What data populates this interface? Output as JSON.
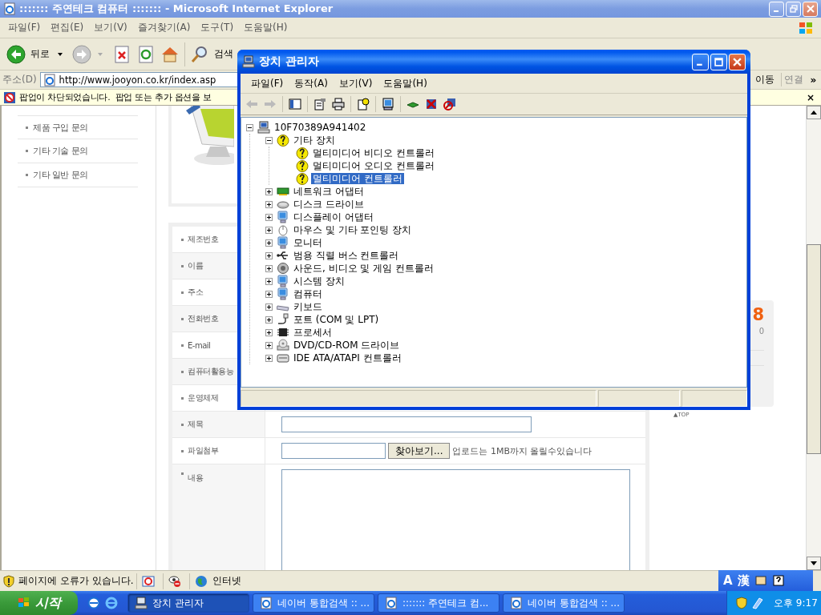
{
  "browser": {
    "title": "::::::: 주연테크 컴퓨터 ::::::: - Microsoft Internet Explorer",
    "menu": [
      "파일(F)",
      "편집(E)",
      "보기(V)",
      "즐겨찾기(A)",
      "도구(T)",
      "도움말(H)"
    ],
    "toolbar": {
      "back": "뒤로",
      "search": "검색"
    },
    "address": {
      "label": "주소(D)",
      "value": "http://www.jooyon.co.kr/index.asp",
      "go": "이동",
      "links": "연결",
      "more": "»"
    },
    "infobar": {
      "text": "팝업이 차단되었습니다.  팝업 또는 추가 옵션을 보",
      "close": "×"
    }
  },
  "page": {
    "sidebar_links": [
      "제품 구입 문의",
      "기타 기술 문의",
      "기타 일반 문의"
    ],
    "form_rows": [
      {
        "label": "제조번호",
        "kind": "label"
      },
      {
        "label": "이름",
        "kind": "label"
      },
      {
        "label": "주소",
        "kind": "label"
      },
      {
        "label": "전화번호",
        "kind": "label"
      },
      {
        "label": "E-mail",
        "kind": "label"
      },
      {
        "label": "컴퓨터활용능",
        "kind": "label"
      },
      {
        "label": "운영체제",
        "kind": "label"
      },
      {
        "label": "제목",
        "kind": "text"
      },
      {
        "label": "파일첨부",
        "kind": "file",
        "button": "찾아보기...",
        "note": "업로드는 1MB까지 올릴수있습니다"
      },
      {
        "label": "내용",
        "kind": "textarea"
      }
    ],
    "side_card": {
      "number": "8",
      "sub": "0"
    },
    "top_link": "▲TOP"
  },
  "status_bar": {
    "text": "페이지에 오류가 있습니다.",
    "zone": "인터넷"
  },
  "device_manager": {
    "title": "장치 관리자",
    "menu": [
      "파일(F)",
      "동작(A)",
      "보기(V)",
      "도움말(H)"
    ],
    "tree": {
      "label": "10F70389A941402",
      "kind": "computer",
      "expanded": true,
      "selected": false,
      "children": [
        {
          "label": "기타 장치",
          "kind": "unknown",
          "expanded": true,
          "selected": false,
          "children": [
            {
              "label": "멀티미디어 비디오 컨트롤러",
              "kind": "warning",
              "selected": false
            },
            {
              "label": "멀티미디어 오디오 컨트롤러",
              "kind": "warning",
              "selected": false
            },
            {
              "label": "멀티미디어 컨트롤러",
              "kind": "warning",
              "selected": true
            }
          ]
        },
        {
          "label": "네트워크 어댑터",
          "kind": "network",
          "expanded": false,
          "selected": false
        },
        {
          "label": "디스크 드라이브",
          "kind": "disk",
          "expanded": false,
          "selected": false
        },
        {
          "label": "디스플레이 어댑터",
          "kind": "display",
          "expanded": false,
          "selected": false
        },
        {
          "label": "마우스 및 기타 포인팅 장치",
          "kind": "mouse",
          "expanded": false,
          "selected": false
        },
        {
          "label": "모니터",
          "kind": "display",
          "expanded": false,
          "selected": false
        },
        {
          "label": "범용 직렬 버스 컨트롤러",
          "kind": "usb",
          "expanded": false,
          "selected": false
        },
        {
          "label": "사운드, 비디오 및 게임 컨트롤러",
          "kind": "sound",
          "expanded": false,
          "selected": false
        },
        {
          "label": "시스템 장치",
          "kind": "display",
          "expanded": false,
          "selected": false
        },
        {
          "label": "컴퓨터",
          "kind": "display",
          "expanded": false,
          "selected": false
        },
        {
          "label": "키보드",
          "kind": "keyboard",
          "expanded": false,
          "selected": false
        },
        {
          "label": "포트 (COM 및 LPT)",
          "kind": "port",
          "expanded": false,
          "selected": false
        },
        {
          "label": "프로세서",
          "kind": "cpu",
          "expanded": false,
          "selected": false
        },
        {
          "label": "DVD/CD-ROM 드라이브",
          "kind": "dvd",
          "expanded": false,
          "selected": false
        },
        {
          "label": "IDE ATA/ATAPI 컨트롤러",
          "kind": "ide",
          "expanded": false,
          "selected": false
        }
      ]
    }
  },
  "taskbar": {
    "start": "시작",
    "tasks": [
      {
        "label": "장치 관리자",
        "selected": true
      },
      {
        "label": "네이버 통합검색 :: ...",
        "selected": false
      },
      {
        "label": "::::::: 주연테크 컴...",
        "selected": false
      },
      {
        "label": "네이버 통합검색 :: ...",
        "selected": false
      }
    ],
    "language": [
      "A",
      "漢"
    ],
    "clock": "오후 9:17"
  }
}
